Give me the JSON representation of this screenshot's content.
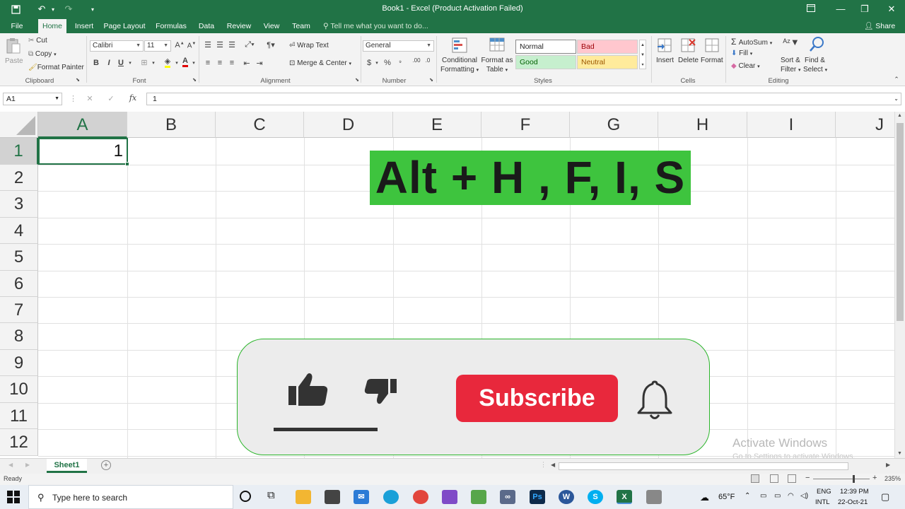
{
  "window": {
    "title": "Book1 - Excel (Product Activation Failed)"
  },
  "tabs": [
    {
      "label": "File"
    },
    {
      "label": "Home"
    },
    {
      "label": "Insert"
    },
    {
      "label": "Page Layout"
    },
    {
      "label": "Formulas"
    },
    {
      "label": "Data"
    },
    {
      "label": "Review"
    },
    {
      "label": "View"
    },
    {
      "label": "Team"
    }
  ],
  "tell_me": "Tell me what you want to do...",
  "share": "Share",
  "ribbon": {
    "clipboard": {
      "paste": "Paste",
      "cut": "Cut",
      "copy": "Copy",
      "format_painter": "Format Painter",
      "label": "Clipboard"
    },
    "font": {
      "name": "Calibri",
      "size": "11",
      "bold": "B",
      "italic": "I",
      "underline": "U",
      "label": "Font"
    },
    "alignment": {
      "wrap_text": "Wrap Text",
      "merge_center": "Merge & Center",
      "label": "Alignment"
    },
    "number": {
      "format": "General",
      "currency": "$",
      "percent": "%",
      "label": "Number"
    },
    "styles": {
      "conditional_formatting_1": "Conditional",
      "conditional_formatting_2": "Formatting",
      "format_as_table_1": "Format as",
      "format_as_table_2": "Table",
      "normal": "Normal",
      "bad": "Bad",
      "good": "Good",
      "neutral": "Neutral",
      "label": "Styles"
    },
    "cells": {
      "insert": "Insert",
      "delete": "Delete",
      "format": "Format",
      "label": "Cells"
    },
    "editing": {
      "autosum": "AutoSum",
      "fill": "Fill",
      "clear": "Clear",
      "sort_filter_1": "Sort &",
      "sort_filter_2": "Filter",
      "find_select_1": "Find &",
      "find_select_2": "Select",
      "label": "Editing"
    }
  },
  "formula_bar": {
    "name_box": "A1",
    "fx": "fx",
    "value": "1"
  },
  "grid": {
    "columns": [
      "A",
      "B",
      "C",
      "D",
      "E",
      "F",
      "G",
      "H",
      "I",
      "J"
    ],
    "rows": [
      "1",
      "2",
      "3",
      "4",
      "5",
      "6",
      "7",
      "8",
      "9",
      "10",
      "11",
      "12"
    ],
    "a1_value": "1"
  },
  "overlay": {
    "shortcut": "Alt + H , F, I, S",
    "subscribe": "Subscribe",
    "banner_color": "#3ec43e",
    "subscribe_color": "#e8283c"
  },
  "watermark": {
    "title": "Activate Windows",
    "subtitle": "Go to Settings to activate Windows."
  },
  "sheets": [
    {
      "label": "Sheet1"
    }
  ],
  "status": {
    "ready": "Ready",
    "zoom": "235%"
  },
  "taskbar": {
    "search_placeholder": "Type here to search",
    "weather": "65°F",
    "lang_1": "ENG",
    "lang_2": "INTL",
    "time": "12:39 PM",
    "date": "22-Oct-21"
  }
}
